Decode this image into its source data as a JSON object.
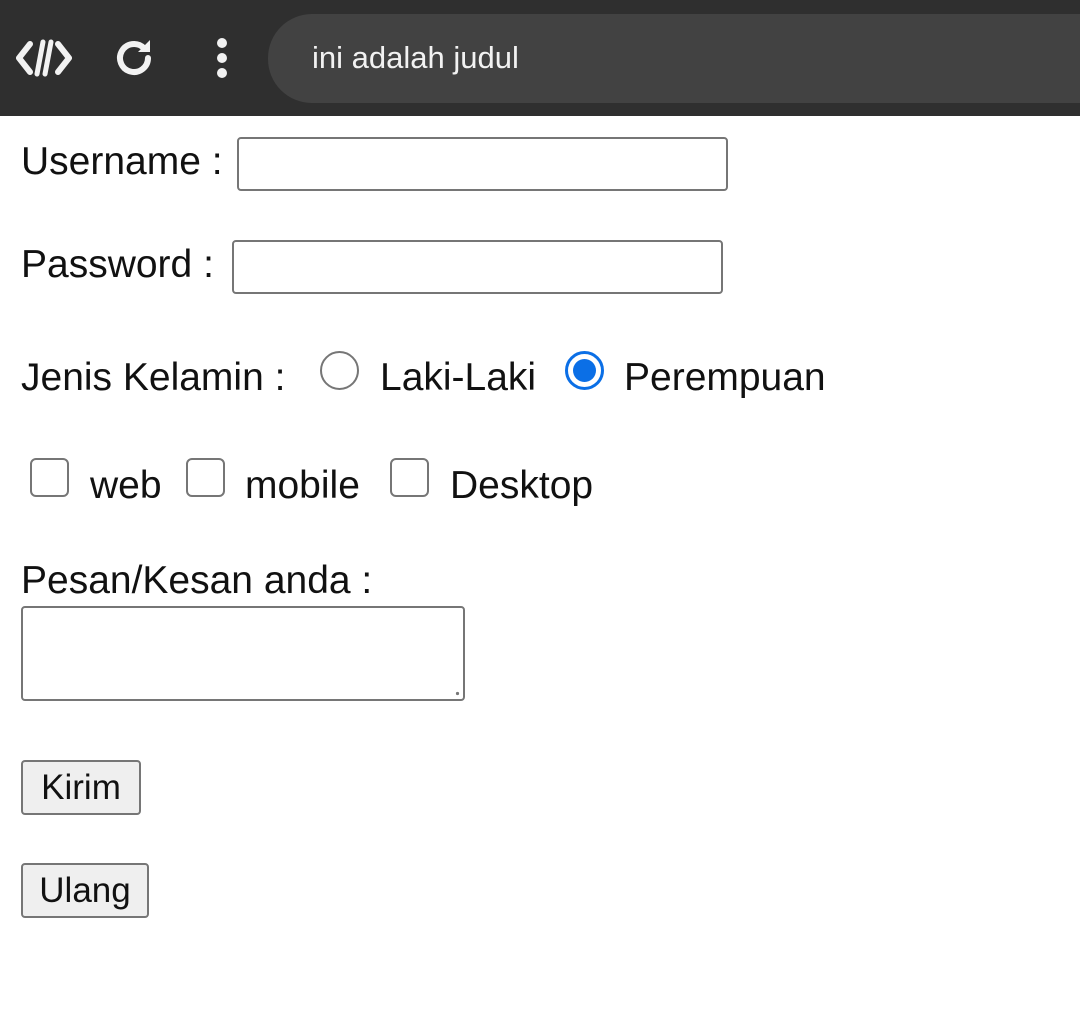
{
  "browser": {
    "page_title": "ini adalah judul",
    "icons": [
      "devtools-icon",
      "reload-icon",
      "more-menu-icon"
    ]
  },
  "form": {
    "username_label": "Username :",
    "username_value": "",
    "password_label": "Password :",
    "password_value": "",
    "gender_label": "Jenis Kelamin :",
    "gender_options": [
      {
        "label": "Laki-Laki",
        "checked": false
      },
      {
        "label": "Perempuan",
        "checked": true
      }
    ],
    "platform_options": [
      {
        "label": "web",
        "checked": false
      },
      {
        "label": "mobile",
        "checked": false
      },
      {
        "label": "Desktop",
        "checked": false
      }
    ],
    "message_label": "Pesan/Kesan anda :",
    "message_value": "",
    "submit_label": "Kirim",
    "reset_label": "Ulang"
  },
  "colors": {
    "toolbar_bg": "#2f2f2f",
    "url_bar_bg": "#424242",
    "radio_accent": "#0b6fe6"
  }
}
